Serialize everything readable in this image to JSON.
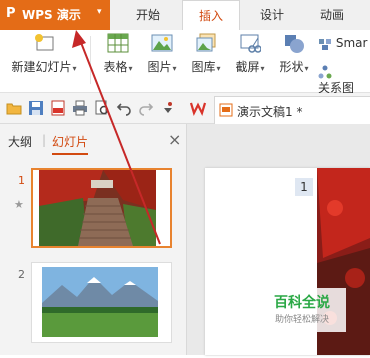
{
  "app": {
    "logo": "P",
    "name": "WPS 演示",
    "caret": "▾"
  },
  "tabs": [
    {
      "label": "开始"
    },
    {
      "label": "插入",
      "active": true
    },
    {
      "label": "设计"
    },
    {
      "label": "动画"
    }
  ],
  "ribbon": {
    "new_slide": "新建幻灯片",
    "table": "表格",
    "picture": "图片",
    "gallery": "图库",
    "screenshot": "截屏",
    "shape": "形状",
    "smart_short": "Smar",
    "relation": "关系图"
  },
  "document": {
    "name": "演示文稿1 *"
  },
  "left_pane": {
    "outline_tab": "大纲",
    "slides_tab": "幻灯片",
    "close": "×",
    "slide1_num": "1",
    "slide2_num": "2",
    "star": "★"
  },
  "editor": {
    "slide_number": "1"
  },
  "watermark": {
    "title": "百科全说",
    "subtitle": "助你轻松解决"
  },
  "colors": {
    "accent": "#e46c17",
    "active_tab_text": "#d24a10",
    "selection": "#e8832f",
    "arrow": "#c62828"
  }
}
